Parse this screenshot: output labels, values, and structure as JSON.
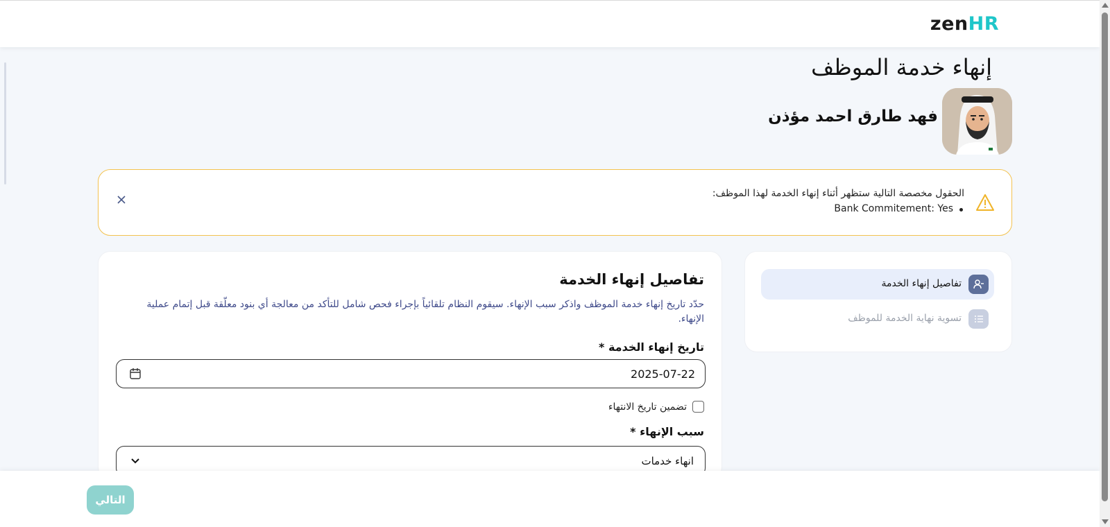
{
  "brand": {
    "logo_part1": "zen",
    "logo_part2": "HR",
    "accent": "#1fc6c9"
  },
  "page": {
    "title": "إنهاء خدمة الموظف",
    "employee_name": "فهد طارق احمد مؤذن"
  },
  "alert": {
    "message": "الحقول مخصصة التالية ستظهر أثناء إنهاء الخدمة لهذا الموظف:",
    "items": [
      {
        "text": "Bank Commitement: Yes"
      }
    ],
    "icon": "warning-icon",
    "close_icon": "close-icon",
    "border_color": "#f3c24f"
  },
  "steps": [
    {
      "label": "تفاصيل إنهاء الخدمة",
      "icon": "user-minus-icon",
      "active": true
    },
    {
      "label": "تسوية نهاية الخدمة للموظف",
      "icon": "list-icon",
      "active": false
    }
  ],
  "form": {
    "section_title": "تفاصيل إنهاء الخدمة",
    "section_description": "حدّد تاريخ إنهاء خدمة الموظف واذكر سبب الإنهاء. سيقوم النظام تلقائياً بإجراء فحص شامل للتأكد من معالجة أي بنود معلّقة قبل إتمام عملية الإنهاء.",
    "date_label": "تاريخ إنهاء الخدمة",
    "required_mark": "*",
    "date_value": "2025-07-22",
    "include_end_date_label": "تضمين تاريخ الانتهاء",
    "include_end_date_checked": false,
    "reason_label": "سبب الإنهاء",
    "reason_value": "انهاء خدمات"
  },
  "footer": {
    "next_label": "التالي",
    "next_color": "#8fd3cf"
  }
}
